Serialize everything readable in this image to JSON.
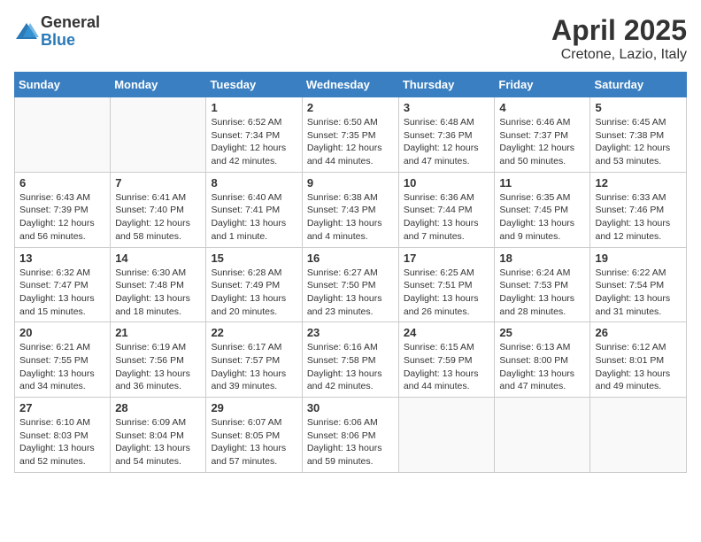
{
  "logo": {
    "general": "General",
    "blue": "Blue"
  },
  "title": "April 2025",
  "subtitle": "Cretone, Lazio, Italy",
  "days_header": [
    "Sunday",
    "Monday",
    "Tuesday",
    "Wednesday",
    "Thursday",
    "Friday",
    "Saturday"
  ],
  "weeks": [
    [
      {
        "day": "",
        "sunrise": "",
        "sunset": "",
        "daylight": ""
      },
      {
        "day": "",
        "sunrise": "",
        "sunset": "",
        "daylight": ""
      },
      {
        "day": "1",
        "sunrise": "Sunrise: 6:52 AM",
        "sunset": "Sunset: 7:34 PM",
        "daylight": "Daylight: 12 hours and 42 minutes."
      },
      {
        "day": "2",
        "sunrise": "Sunrise: 6:50 AM",
        "sunset": "Sunset: 7:35 PM",
        "daylight": "Daylight: 12 hours and 44 minutes."
      },
      {
        "day": "3",
        "sunrise": "Sunrise: 6:48 AM",
        "sunset": "Sunset: 7:36 PM",
        "daylight": "Daylight: 12 hours and 47 minutes."
      },
      {
        "day": "4",
        "sunrise": "Sunrise: 6:46 AM",
        "sunset": "Sunset: 7:37 PM",
        "daylight": "Daylight: 12 hours and 50 minutes."
      },
      {
        "day": "5",
        "sunrise": "Sunrise: 6:45 AM",
        "sunset": "Sunset: 7:38 PM",
        "daylight": "Daylight: 12 hours and 53 minutes."
      }
    ],
    [
      {
        "day": "6",
        "sunrise": "Sunrise: 6:43 AM",
        "sunset": "Sunset: 7:39 PM",
        "daylight": "Daylight: 12 hours and 56 minutes."
      },
      {
        "day": "7",
        "sunrise": "Sunrise: 6:41 AM",
        "sunset": "Sunset: 7:40 PM",
        "daylight": "Daylight: 12 hours and 58 minutes."
      },
      {
        "day": "8",
        "sunrise": "Sunrise: 6:40 AM",
        "sunset": "Sunset: 7:41 PM",
        "daylight": "Daylight: 13 hours and 1 minute."
      },
      {
        "day": "9",
        "sunrise": "Sunrise: 6:38 AM",
        "sunset": "Sunset: 7:43 PM",
        "daylight": "Daylight: 13 hours and 4 minutes."
      },
      {
        "day": "10",
        "sunrise": "Sunrise: 6:36 AM",
        "sunset": "Sunset: 7:44 PM",
        "daylight": "Daylight: 13 hours and 7 minutes."
      },
      {
        "day": "11",
        "sunrise": "Sunrise: 6:35 AM",
        "sunset": "Sunset: 7:45 PM",
        "daylight": "Daylight: 13 hours and 9 minutes."
      },
      {
        "day": "12",
        "sunrise": "Sunrise: 6:33 AM",
        "sunset": "Sunset: 7:46 PM",
        "daylight": "Daylight: 13 hours and 12 minutes."
      }
    ],
    [
      {
        "day": "13",
        "sunrise": "Sunrise: 6:32 AM",
        "sunset": "Sunset: 7:47 PM",
        "daylight": "Daylight: 13 hours and 15 minutes."
      },
      {
        "day": "14",
        "sunrise": "Sunrise: 6:30 AM",
        "sunset": "Sunset: 7:48 PM",
        "daylight": "Daylight: 13 hours and 18 minutes."
      },
      {
        "day": "15",
        "sunrise": "Sunrise: 6:28 AM",
        "sunset": "Sunset: 7:49 PM",
        "daylight": "Daylight: 13 hours and 20 minutes."
      },
      {
        "day": "16",
        "sunrise": "Sunrise: 6:27 AM",
        "sunset": "Sunset: 7:50 PM",
        "daylight": "Daylight: 13 hours and 23 minutes."
      },
      {
        "day": "17",
        "sunrise": "Sunrise: 6:25 AM",
        "sunset": "Sunset: 7:51 PM",
        "daylight": "Daylight: 13 hours and 26 minutes."
      },
      {
        "day": "18",
        "sunrise": "Sunrise: 6:24 AM",
        "sunset": "Sunset: 7:53 PM",
        "daylight": "Daylight: 13 hours and 28 minutes."
      },
      {
        "day": "19",
        "sunrise": "Sunrise: 6:22 AM",
        "sunset": "Sunset: 7:54 PM",
        "daylight": "Daylight: 13 hours and 31 minutes."
      }
    ],
    [
      {
        "day": "20",
        "sunrise": "Sunrise: 6:21 AM",
        "sunset": "Sunset: 7:55 PM",
        "daylight": "Daylight: 13 hours and 34 minutes."
      },
      {
        "day": "21",
        "sunrise": "Sunrise: 6:19 AM",
        "sunset": "Sunset: 7:56 PM",
        "daylight": "Daylight: 13 hours and 36 minutes."
      },
      {
        "day": "22",
        "sunrise": "Sunrise: 6:17 AM",
        "sunset": "Sunset: 7:57 PM",
        "daylight": "Daylight: 13 hours and 39 minutes."
      },
      {
        "day": "23",
        "sunrise": "Sunrise: 6:16 AM",
        "sunset": "Sunset: 7:58 PM",
        "daylight": "Daylight: 13 hours and 42 minutes."
      },
      {
        "day": "24",
        "sunrise": "Sunrise: 6:15 AM",
        "sunset": "Sunset: 7:59 PM",
        "daylight": "Daylight: 13 hours and 44 minutes."
      },
      {
        "day": "25",
        "sunrise": "Sunrise: 6:13 AM",
        "sunset": "Sunset: 8:00 PM",
        "daylight": "Daylight: 13 hours and 47 minutes."
      },
      {
        "day": "26",
        "sunrise": "Sunrise: 6:12 AM",
        "sunset": "Sunset: 8:01 PM",
        "daylight": "Daylight: 13 hours and 49 minutes."
      }
    ],
    [
      {
        "day": "27",
        "sunrise": "Sunrise: 6:10 AM",
        "sunset": "Sunset: 8:03 PM",
        "daylight": "Daylight: 13 hours and 52 minutes."
      },
      {
        "day": "28",
        "sunrise": "Sunrise: 6:09 AM",
        "sunset": "Sunset: 8:04 PM",
        "daylight": "Daylight: 13 hours and 54 minutes."
      },
      {
        "day": "29",
        "sunrise": "Sunrise: 6:07 AM",
        "sunset": "Sunset: 8:05 PM",
        "daylight": "Daylight: 13 hours and 57 minutes."
      },
      {
        "day": "30",
        "sunrise": "Sunrise: 6:06 AM",
        "sunset": "Sunset: 8:06 PM",
        "daylight": "Daylight: 13 hours and 59 minutes."
      },
      {
        "day": "",
        "sunrise": "",
        "sunset": "",
        "daylight": ""
      },
      {
        "day": "",
        "sunrise": "",
        "sunset": "",
        "daylight": ""
      },
      {
        "day": "",
        "sunrise": "",
        "sunset": "",
        "daylight": ""
      }
    ]
  ]
}
